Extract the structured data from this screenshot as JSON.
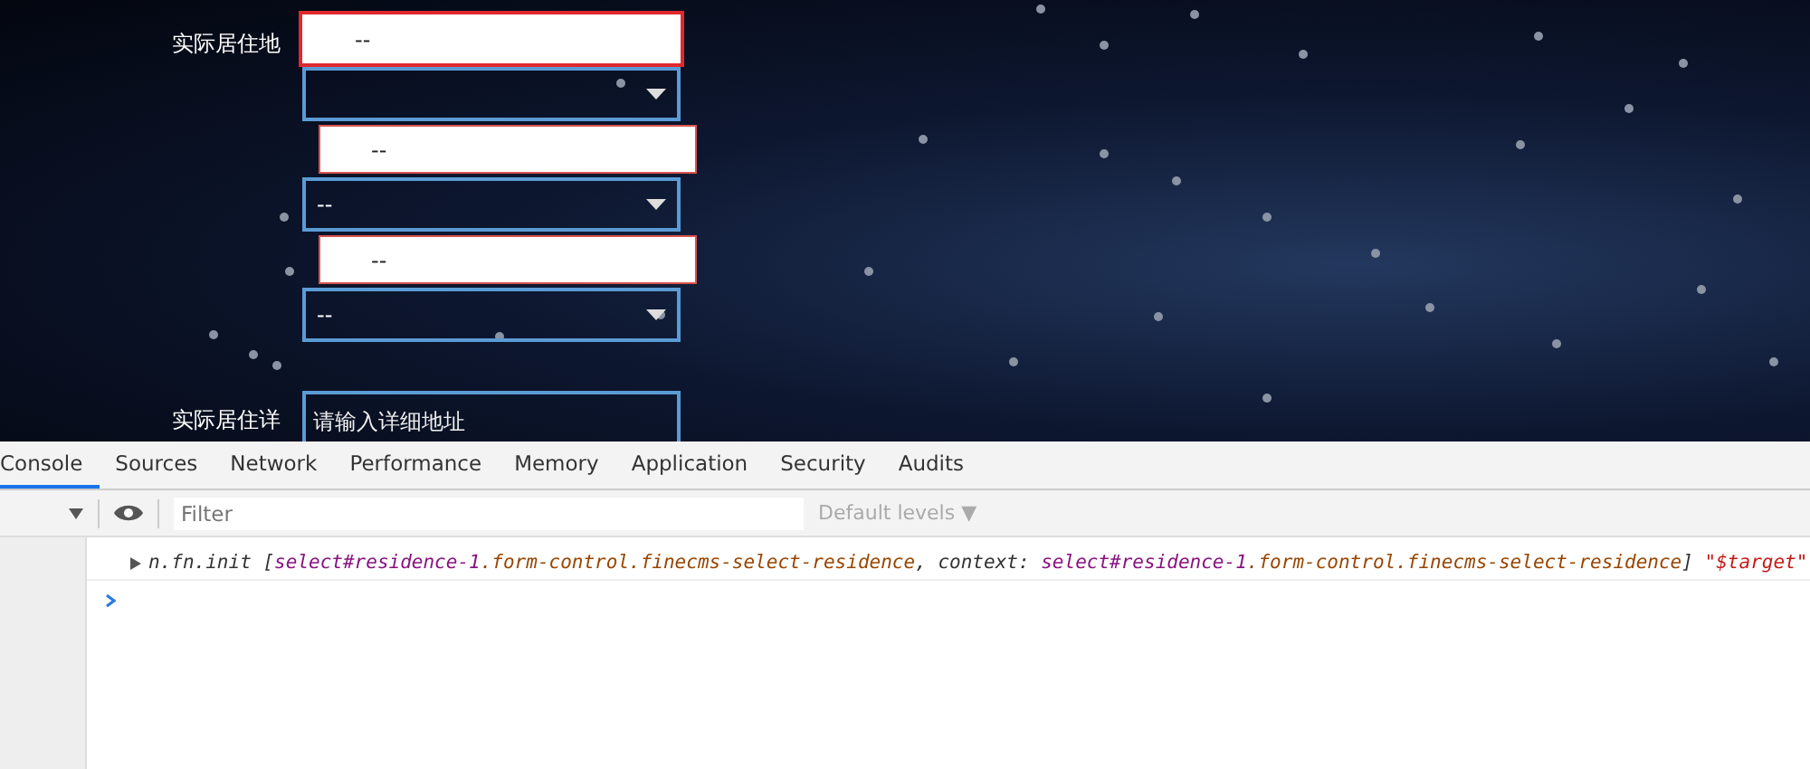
{
  "form": {
    "address_label": "实际居住地",
    "fields": [
      {
        "kind": "input",
        "value": "--",
        "highlighted": true
      },
      {
        "kind": "select",
        "highlighted": false
      },
      {
        "kind": "input",
        "value": "--",
        "highlighted": false
      },
      {
        "kind": "select",
        "value": "--",
        "highlighted": false
      },
      {
        "kind": "input",
        "value": "--",
        "highlighted": false
      },
      {
        "kind": "select",
        "value": "--",
        "highlighted": false
      }
    ],
    "detail_label": "实际居住详",
    "detail_placeholder": "请输入详细地址"
  },
  "devtools": {
    "tabs": [
      {
        "label": "Console",
        "selected": true
      },
      {
        "label": "Sources",
        "selected": false
      },
      {
        "label": "Network",
        "selected": false
      },
      {
        "label": "Performance",
        "selected": false
      },
      {
        "label": "Memory",
        "selected": false
      },
      {
        "label": "Application",
        "selected": false
      },
      {
        "label": "Security",
        "selected": false
      },
      {
        "label": "Audits",
        "selected": false
      }
    ],
    "filter_placeholder": "Filter",
    "levels": "Default levels ▼",
    "messages": [
      {
        "parts": [
          {
            "kind": "plain",
            "text": "n.fn.init ["
          },
          {
            "kind": "tag",
            "text": "select#residence-1"
          },
          {
            "kind": "cls",
            "text": ".form-control.finecms-select-residence"
          },
          {
            "kind": "plain",
            "text": ", context: "
          },
          {
            "kind": "tag",
            "text": "select#residence-1"
          },
          {
            "kind": "cls",
            "text": ".form-control.finecms-select-residence"
          },
          {
            "kind": "plain",
            "text": "] "
          },
          {
            "kind": "str",
            "text": "\"$target\""
          }
        ]
      }
    ]
  }
}
